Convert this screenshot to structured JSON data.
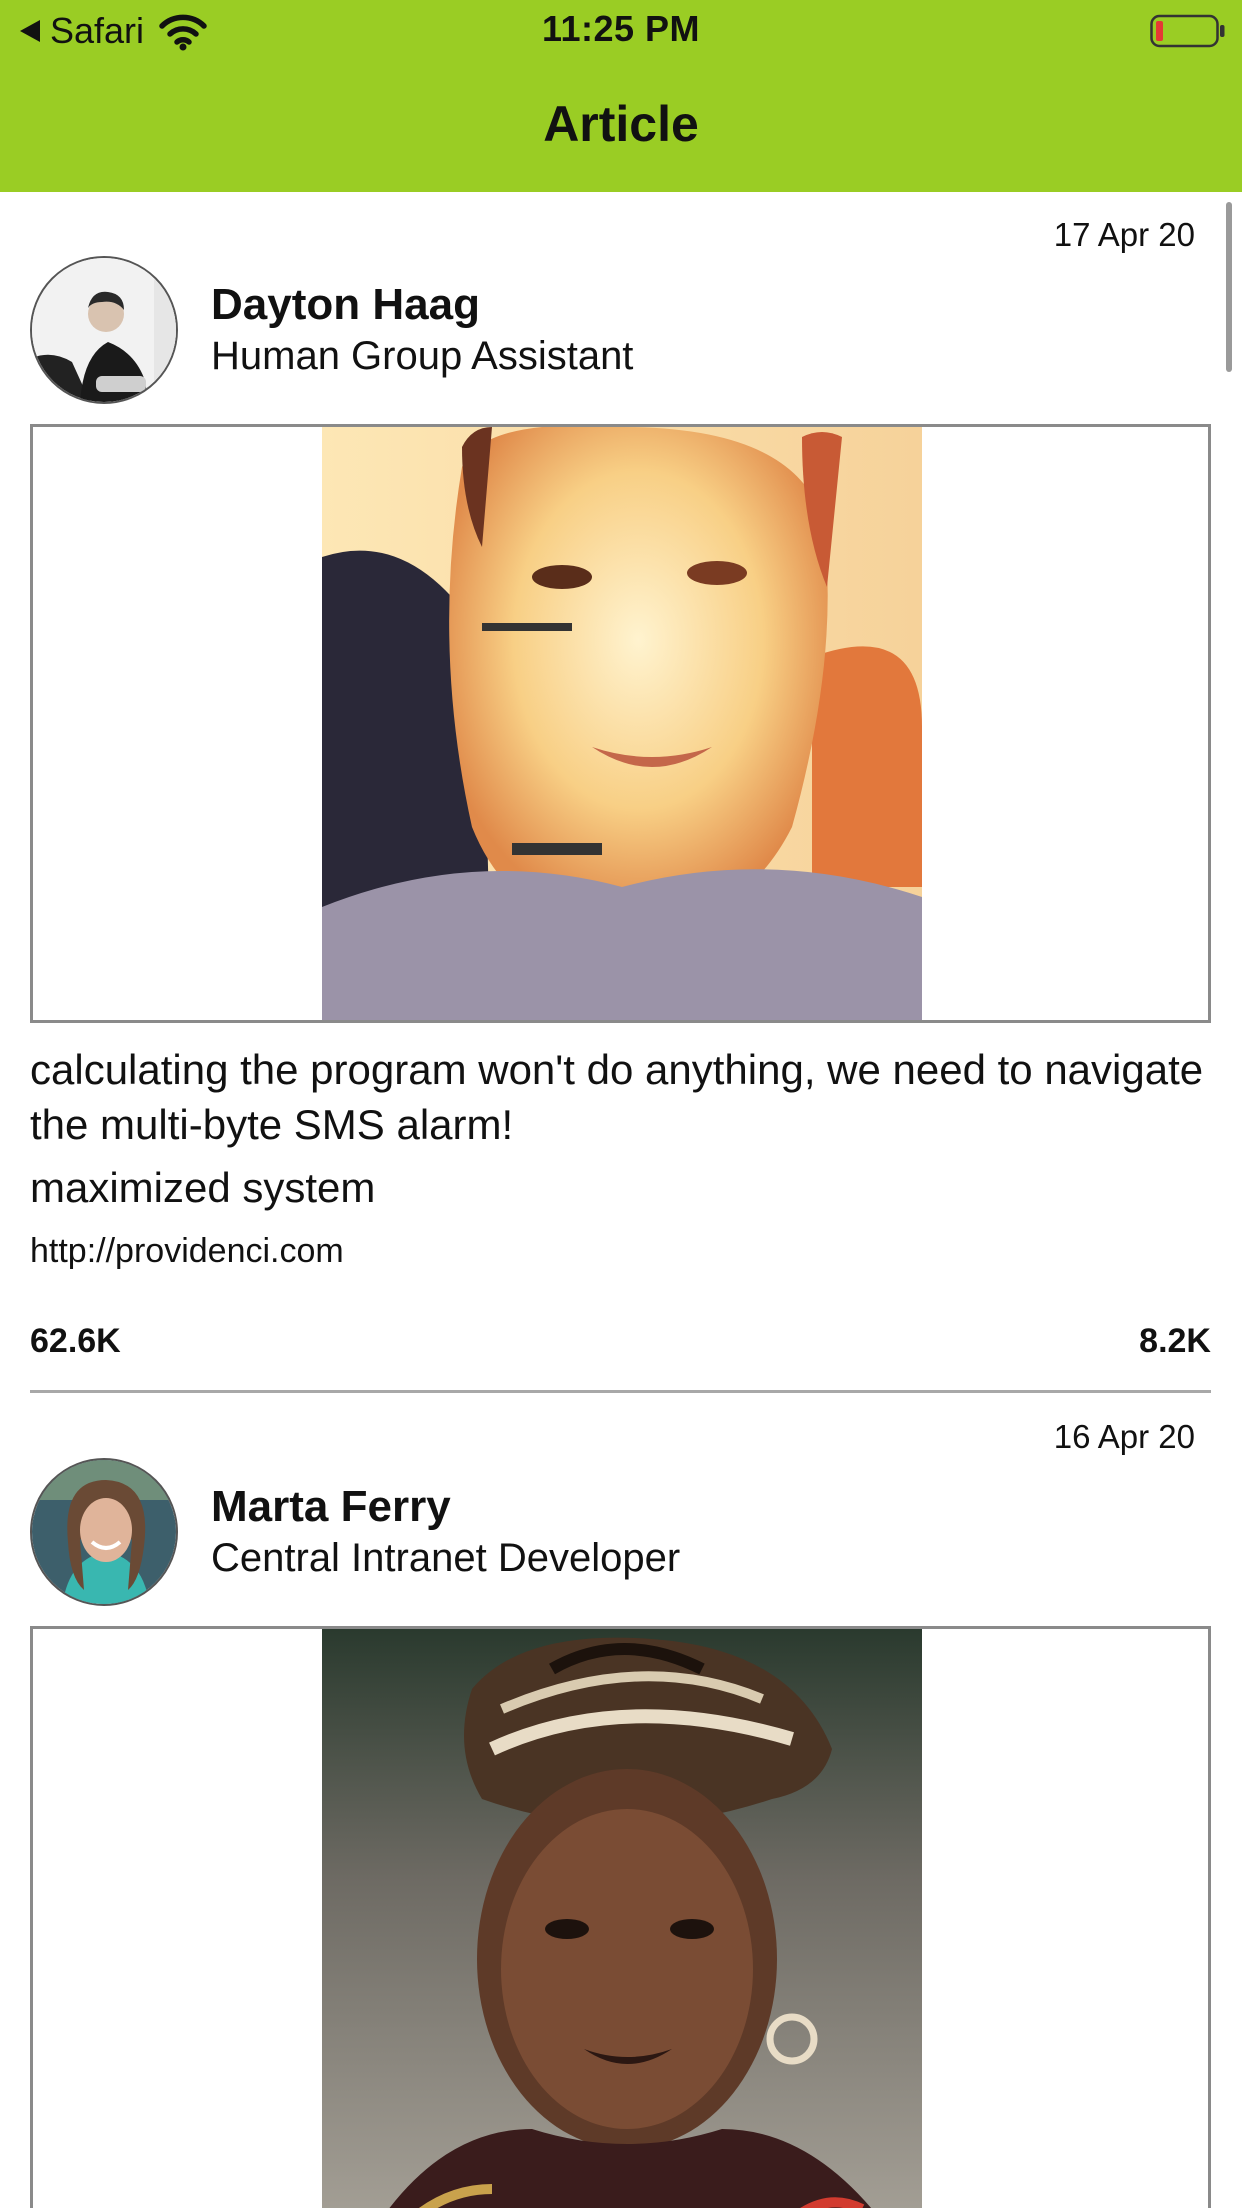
{
  "status_bar": {
    "back_app_label": "Safari",
    "time": "11:25 PM",
    "battery_color": "#E53935",
    "wifi_icon": "wifi-icon",
    "battery_icon": "battery-icon"
  },
  "nav": {
    "title": "Article",
    "background_color": "#9ACD24"
  },
  "posts": [
    {
      "date": "17 Apr 20",
      "author_name": "Dayton Haag",
      "author_title": "Human Group Assistant",
      "text": "calculating the program won't do anything, we need to navigate the multi-byte SMS alarm!",
      "tag": "maximized system",
      "link": "http://providenci.com",
      "left_stat": "62.6K",
      "right_stat": "8.2K"
    },
    {
      "date": "16 Apr 20",
      "author_name": "Marta Ferry",
      "author_title": "Central Intranet Developer"
    }
  ]
}
